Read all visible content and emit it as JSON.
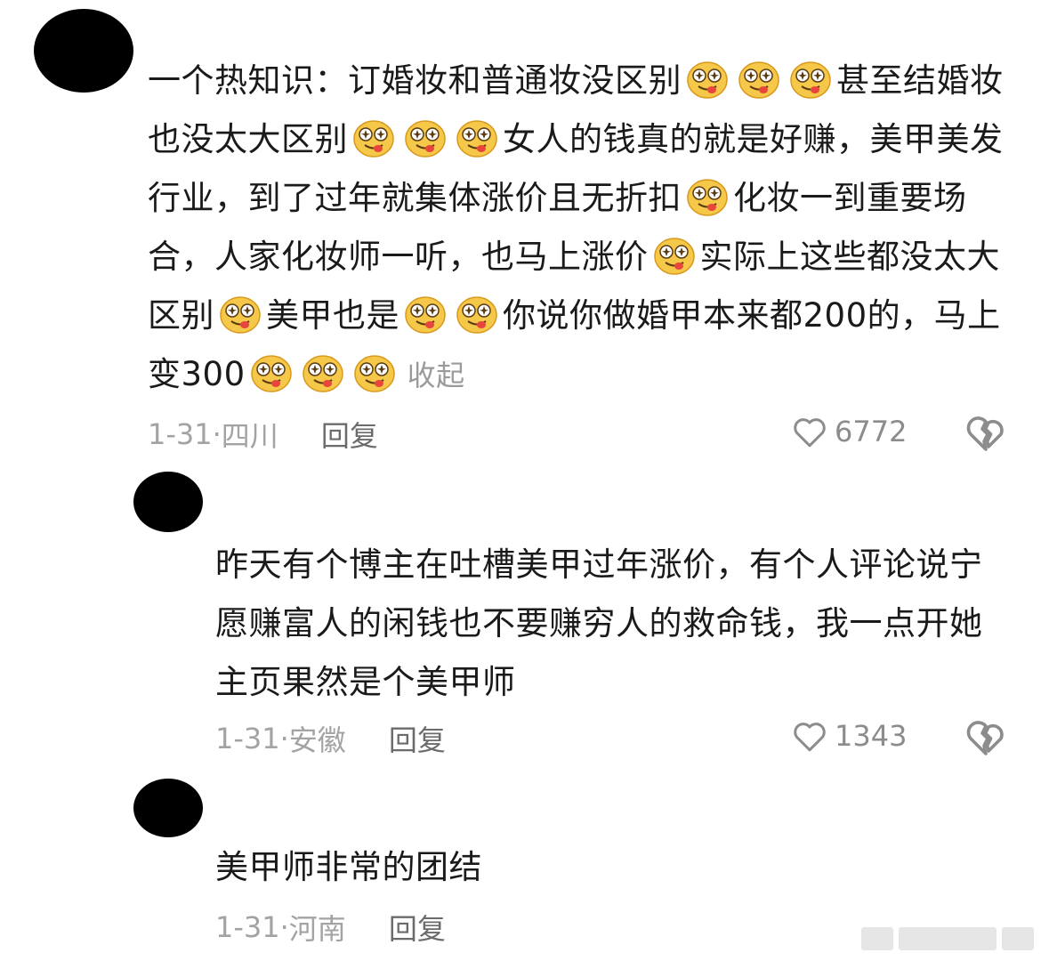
{
  "comments": [
    {
      "segments": [
        "一个热知识：订婚妆和普通妆没区别",
        "甚至结婚妆也没太大区别",
        "女人的钱真的就是好赚，美甲美发行业，到了过年就集体涨价且无折扣",
        "化妆一到重要场合，人家化妆师一听，也马上涨价",
        "实际上这些都没太大区别",
        "美甲也是",
        "你说你做婚甲本来都200的，马上变300"
      ],
      "collapse_label": "收起",
      "date": "1-31",
      "location": "四川",
      "reply_label": "回复",
      "likes": "6772"
    },
    {
      "text": "昨天有个博主在吐槽美甲过年涨价，有个人评论说宁愿赚富人的闲钱也不要赚穷人的救命钱，我一点开她主页果然是个美甲师",
      "date": "1-31",
      "location": "安徽",
      "reply_label": "回复",
      "likes": "1343"
    },
    {
      "text": "美甲师非常的团结",
      "date": "1-31",
      "location": "河南",
      "reply_label": "回复"
    }
  ],
  "icons": {
    "emoji": "drooling-star-eyes-emoji",
    "like": "heart-outline-icon",
    "dislike": "broken-heart-icon"
  },
  "colors": {
    "text": "#1a1a1a",
    "meta": "#a3a3a3",
    "reply": "#6b6b6b",
    "emoji_face": "#f6c84a",
    "emoji_tongue": "#e8453c"
  }
}
